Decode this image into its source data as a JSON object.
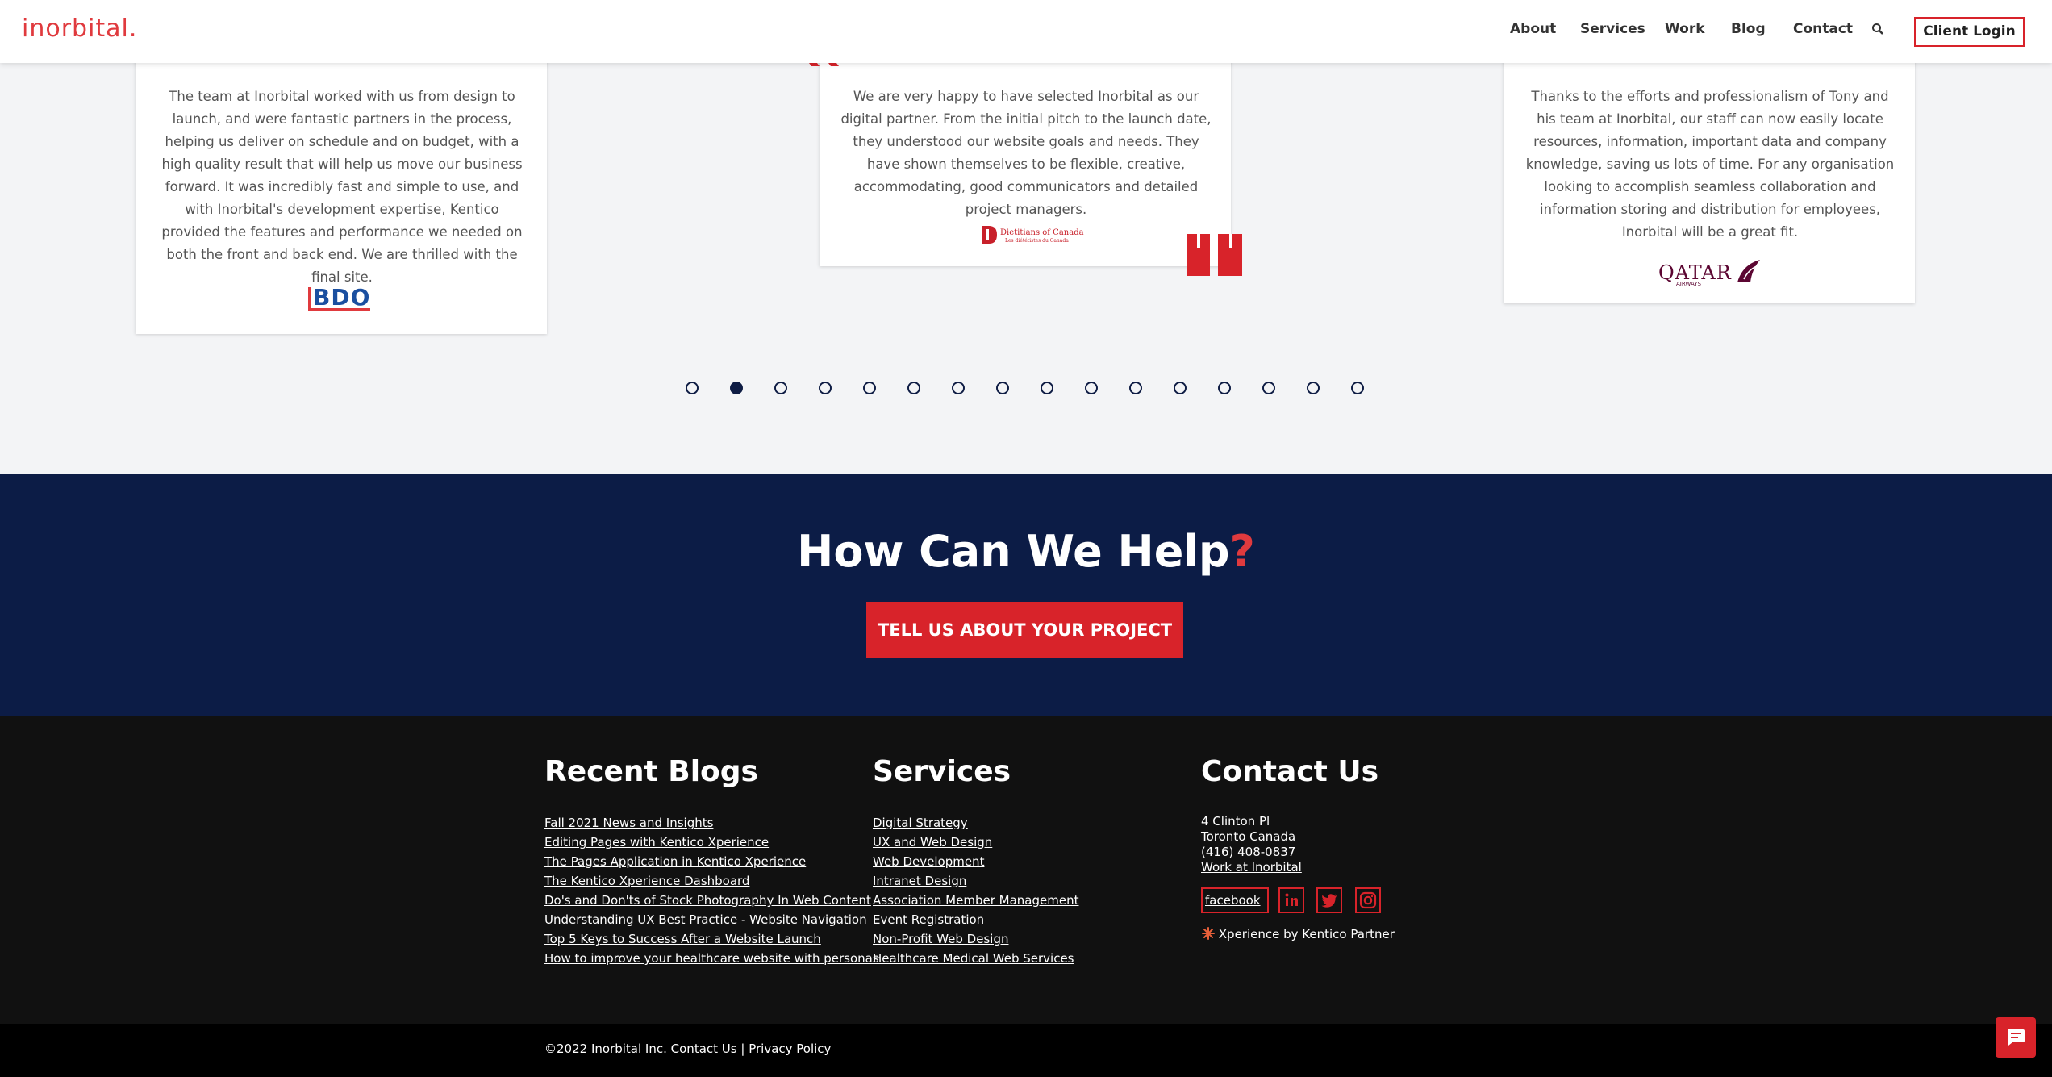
{
  "header": {
    "logo": "inorbital.",
    "nav": [
      "About",
      "Services",
      "Work",
      "Blog",
      "Contact"
    ],
    "search_icon": "search-icon",
    "client_login": "Client Login"
  },
  "testimonials": [
    {
      "text": "The team at Inorbital worked with us from design to launch, and were fantastic partners in the process, helping us deliver on schedule and on budget, with a high quality result that will help us move our business forward. It was incredibly fast and simple to use, and with Inorbital's development expertise, Kentico provided the features and performance we needed on both the front and back end. We are thrilled with the final site.",
      "logo_text": "BDO"
    },
    {
      "text": "We are very happy to have selected Inorbital as our digital partner. From the initial pitch to the launch date, they understood our website goals and needs. They have shown themselves to be flexible, creative, accommodating, good communicators and detailed project managers.",
      "logo_text": "Dietitians of Canada",
      "logo_subtext": "Les diététistes du Canada"
    },
    {
      "text": "Thanks to the efforts and professionalism of Tony and his team at Inorbital, our staff can now easily locate resources, information, important data and company knowledge, saving us lots of time. For any organisation looking to accomplish seamless collaboration and information storing and distribution for employees, Inorbital will be a great fit.",
      "logo_text": "QATAR",
      "logo_subtext": "AIRWAYS"
    }
  ],
  "carousel": {
    "count": 16,
    "active_index": 1
  },
  "cta": {
    "heading": "How Can We Help",
    "heading_mark": "?",
    "button": "TELL US ABOUT YOUR PROJECT"
  },
  "footer": {
    "blogs_title": "Recent Blogs",
    "blogs": [
      "Fall 2021 News and Insights",
      "Editing Pages with Kentico Xperience",
      "The Pages Application in Kentico Xperience",
      "The Kentico Xperience Dashboard",
      "Do's and Don'ts of Stock Photography In Web Content",
      "Understanding UX Best Practice - Website Navigation",
      "Top 5 Keys to Success After a Website Launch",
      "How to improve your healthcare website with personas"
    ],
    "services_title": "Services",
    "services": [
      "Digital Strategy",
      "UX and Web Design",
      "Web Development",
      "Intranet Design",
      "Association Member Management",
      "Event Registration",
      "Non-Profit Web Design",
      "Healthcare Medical Web Services"
    ],
    "contact_title": "Contact Us",
    "address1": "4 Clinton Pl",
    "address2": "Toronto Canada",
    "phone": "(416) 408-0837",
    "work_link": "Work at Inorbital",
    "facebook_alt": "facebook",
    "partner": "Xperience by Kentico Partner"
  },
  "bottom": {
    "copyright": "©2022 Inorbital Inc.",
    "contact_link": "Contact Us",
    "separator": "|",
    "privacy_link": "Privacy Policy"
  },
  "colors": {
    "navy": "#0c1c46",
    "red": "#d8232a",
    "footer": "#111111"
  }
}
